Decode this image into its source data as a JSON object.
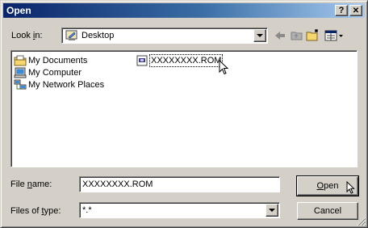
{
  "window": {
    "title": "Open",
    "help_glyph": "?",
    "close_glyph": "✕"
  },
  "lookin": {
    "label_pre": "Look ",
    "label_u": "i",
    "label_post": "n:",
    "value": "Desktop"
  },
  "listview": {
    "items": [
      {
        "label": "My Documents",
        "icon": "my-documents-icon"
      },
      {
        "label": "My Computer",
        "icon": "my-computer-icon"
      },
      {
        "label": "My Network Places",
        "icon": "network-places-icon"
      },
      {
        "label": "XXXXXXXX.ROM",
        "icon": "rom-file-icon"
      }
    ]
  },
  "filename": {
    "label_pre": "File ",
    "label_u": "n",
    "label_post": "ame:",
    "value": "XXXXXXXX.ROM"
  },
  "filetype": {
    "label_pre": "Files of ",
    "label_u": "t",
    "label_post": "ype:",
    "value": "*.*"
  },
  "buttons": {
    "open_u": "O",
    "open_rest": "pen",
    "cancel": "Cancel"
  },
  "colors": {
    "titlebar_start": "#0a246a",
    "titlebar_end": "#a6caf0",
    "face": "#d4d0c8"
  }
}
